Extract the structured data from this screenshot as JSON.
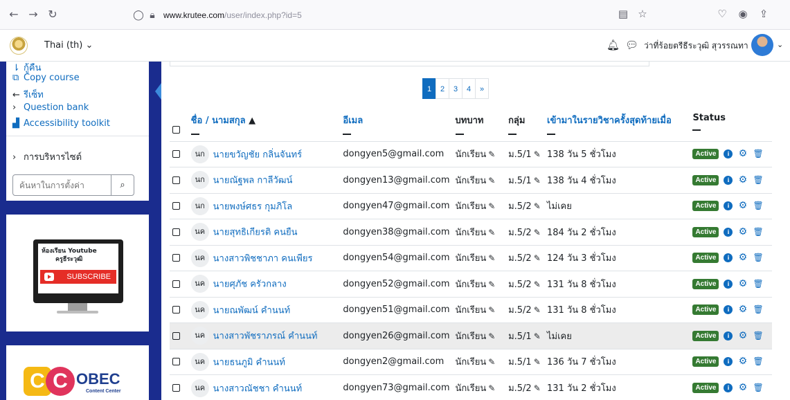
{
  "browser": {
    "back_icon": "arrow-left-icon",
    "url_host": "www.krutee.com",
    "url_path": "/user/index.php?id=5"
  },
  "navbar": {
    "language": "Thai (th) ⌄",
    "user_name": "ว่าที่ร้อยตรีธีระวุฒิ สุวรรณทา"
  },
  "drawer": {
    "items": [
      {
        "icon": "people-icon",
        "label": "กู้คืน"
      },
      {
        "icon": "copy-icon",
        "label": "Copy course"
      },
      {
        "icon": "arrow-left-icon",
        "label": "รีเซ็ท"
      },
      {
        "icon": "chevron-right-icon",
        "label": "Question bank"
      },
      {
        "icon": "accessibility-icon",
        "label": "Accessibility toolkit"
      }
    ],
    "site_admin": "การบริหารไซต์",
    "search_placeholder": "ค้นหาในการตั้งค่า",
    "youtube_title": "ห้องเรียน Youtube",
    "youtube_channel": "ครูธีระวุฒิ",
    "youtube_subscribe": "SUBSCRIBE",
    "obec_title": "OBEC",
    "obec_subtitle": "Content Center"
  },
  "pagination": {
    "pages": [
      "1",
      "2",
      "3",
      "4",
      "»"
    ],
    "active": "1"
  },
  "table": {
    "headers": {
      "name": "ชื่อ / นามสกุล",
      "email": "อีเมล",
      "role": "บทบาท",
      "group": "กลุ่ม",
      "last_access": "เข้ามาในรายวิชาครั้งสุดท้ายเมื่อ",
      "status": "Status"
    },
    "rows": [
      {
        "initials": "นก",
        "name": "นายขวัญชัย กลิ่นจันทร์",
        "email": "dongyen5@gmail.com",
        "role": "นักเรียน",
        "group": "ม.5/1",
        "last_access": "138 วัน 5 ชั่วโมง",
        "status": "Active"
      },
      {
        "initials": "นก",
        "name": "นายณัฐพล กาลีวัฒน์",
        "email": "dongyen13@gmail.com",
        "role": "นักเรียน",
        "group": "ม.5/1",
        "last_access": "138 วัน 4 ชั่วโมง",
        "status": "Active"
      },
      {
        "initials": "นก",
        "name": "นายพงษ์ศธร กุมภิโล",
        "email": "dongyen47@gmail.com",
        "role": "นักเรียน",
        "group": "ม.5/2",
        "last_access": "ไม่เคย",
        "status": "Active"
      },
      {
        "initials": "นค",
        "name": "นายสุทธิเกียรติ คนยืน",
        "email": "dongyen38@gmail.com",
        "role": "นักเรียน",
        "group": "ม.5/2",
        "last_access": "184 วัน 2 ชั่วโมง",
        "status": "Active"
      },
      {
        "initials": "นค",
        "name": "นางสาวพิชชาภา คนเพียร",
        "email": "dongyen54@gmail.com",
        "role": "นักเรียน",
        "group": "ม.5/2",
        "last_access": "124 วัน 3 ชั่วโมง",
        "status": "Active"
      },
      {
        "initials": "นค",
        "name": "นายศุภัช ครัวกลาง",
        "email": "dongyen52@gmail.com",
        "role": "นักเรียน",
        "group": "ม.5/2",
        "last_access": "131 วัน 8 ชั่วโมง",
        "status": "Active"
      },
      {
        "initials": "นค",
        "name": "นายณพัฒน์ คำนนท์",
        "email": "dongyen51@gmail.com",
        "role": "นักเรียน",
        "group": "ม.5/2",
        "last_access": "131 วัน 8 ชั่วโมง",
        "status": "Active"
      },
      {
        "initials": "นค",
        "name": "นางสาวพัชราภรณ์ คำนนท์",
        "email": "dongyen26@gmail.com",
        "role": "นักเรียน",
        "group": "ม.5/1",
        "last_access": "ไม่เคย",
        "status": "Active"
      },
      {
        "initials": "นค",
        "name": "นายธนภูมิ คำนนท์",
        "email": "dongyen2@gmail.com",
        "role": "นักเรียน",
        "group": "ม.5/1",
        "last_access": "136 วัน 7 ชั่วโมง",
        "status": "Active"
      },
      {
        "initials": "นค",
        "name": "นางสาวณัชชา คำนนท์",
        "email": "dongyen73@gmail.com",
        "role": "นักเรียน",
        "group": "ม.5/2",
        "last_access": "131 วัน 2 ชั่วโมง",
        "status": "Active"
      }
    ]
  },
  "colors": {
    "link": "#0f6cbf",
    "drawer_bg": "#1a2c8e",
    "active_badge": "#357a32"
  }
}
